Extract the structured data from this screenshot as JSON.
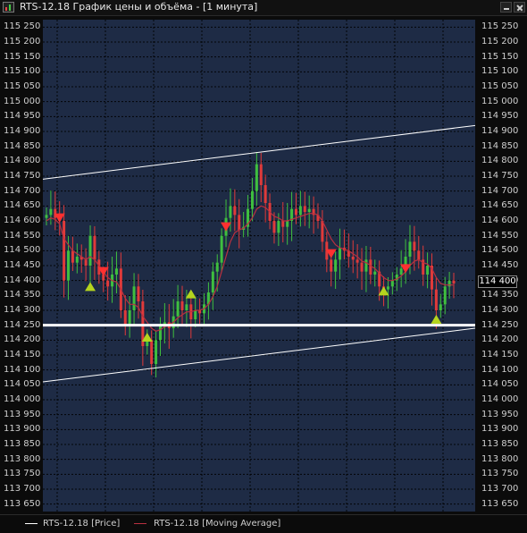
{
  "window": {
    "title": "RTS-12.18 График цены и объёма - [1 минута]"
  },
  "colors": {
    "plot_background": "#1e2b45",
    "grid": "#000000",
    "up_candle": "#3fbf3f",
    "down_candle": "#e03a3a",
    "moving_average": "#b83040",
    "trend_lines": "#ffffff",
    "buy_marker": "#b5d41e",
    "sell_marker": "#ff3030"
  },
  "price_axis": {
    "labels": [
      "115 250",
      "115 200",
      "115 150",
      "115 100",
      "115 050",
      "115 000",
      "114 950",
      "114 900",
      "114 850",
      "114 800",
      "114 750",
      "114 700",
      "114 650",
      "114 600",
      "114 550",
      "114 500",
      "114 450",
      "114 400",
      "114 350",
      "114 300",
      "114 250",
      "114 200",
      "114 150",
      "114 100",
      "114 050",
      "114 000",
      "113 950",
      "113 900",
      "113 850",
      "113 800",
      "113 750",
      "113 700",
      "113 650"
    ]
  },
  "current_price_tag": "114 400",
  "legend": {
    "items": [
      {
        "label": "RTS-12.18 [Price]",
        "color": "#ffffff"
      },
      {
        "label": "RTS-12.18 [Moving Average]",
        "color": "#b83040"
      }
    ]
  },
  "chart_data": {
    "type": "candlestick",
    "title": "",
    "ylim": [
      113625,
      115275
    ],
    "price_series_close": [
      114620,
      114640,
      114610,
      114600,
      114400,
      114500,
      114460,
      114480,
      114470,
      114450,
      114550,
      114470,
      114420,
      114400,
      114380,
      114420,
      114440,
      114300,
      114250,
      114300,
      114380,
      114330,
      114180,
      114200,
      114120,
      114200,
      114250,
      114260,
      114240,
      114280,
      114330,
      114300,
      114320,
      114270,
      114300,
      114290,
      114320,
      114360,
      114430,
      114460,
      114550,
      114610,
      114650,
      114620,
      114570,
      114580,
      114640,
      114700,
      114790,
      114720,
      114660,
      114600,
      114560,
      114600,
      114580,
      114600,
      114640,
      114620,
      114650,
      114630,
      114640,
      114620,
      114600,
      114530,
      114470,
      114430,
      114470,
      114510,
      114500,
      114480,
      114470,
      114460,
      114430,
      114470,
      114420,
      114430,
      114380,
      114370,
      114380,
      114400,
      114420,
      114440,
      114480,
      114530,
      114500,
      114470,
      114420,
      114450,
      114370,
      114300,
      114320,
      114380,
      114400,
      114390
    ],
    "moving_average": [
      114600,
      114610,
      114605,
      114590,
      114540,
      114520,
      114500,
      114490,
      114480,
      114470,
      114480,
      114470,
      114450,
      114430,
      114410,
      114400,
      114395,
      114370,
      114340,
      114320,
      114320,
      114310,
      114280,
      114260,
      114240,
      114230,
      114235,
      114245,
      114250,
      114260,
      114275,
      114285,
      114295,
      114295,
      114300,
      114300,
      114305,
      114320,
      114345,
      114380,
      114430,
      114480,
      114530,
      114560,
      114570,
      114575,
      114590,
      114610,
      114640,
      114650,
      114645,
      114630,
      114615,
      114610,
      114600,
      114600,
      114605,
      114610,
      114615,
      114620,
      114625,
      114625,
      114620,
      114600,
      114570,
      114540,
      114520,
      114510,
      114505,
      114500,
      114490,
      114480,
      114465,
      114460,
      114450,
      114440,
      114425,
      114410,
      114400,
      114400,
      114405,
      114415,
      114430,
      114450,
      114465,
      114470,
      114460,
      114455,
      114440,
      114410,
      114390,
      114385,
      114385,
      114385
    ],
    "buy_signals": [
      {
        "index": 10,
        "price": 114380
      },
      {
        "index": 23,
        "price": 114210
      },
      {
        "index": 33,
        "price": 114355
      },
      {
        "index": 77,
        "price": 114365
      },
      {
        "index": 89,
        "price": 114270
      }
    ],
    "sell_signals": [
      {
        "index": 3,
        "price": 114610
      },
      {
        "index": 13,
        "price": 114430
      },
      {
        "index": 41,
        "price": 114580
      },
      {
        "index": 65,
        "price": 114490
      },
      {
        "index": 82,
        "price": 114440
      }
    ],
    "horizontal_line": 114250,
    "trend_lines": [
      {
        "from_price": 114740,
        "to_price": 114920
      },
      {
        "from_price": 114060,
        "to_price": 114240
      }
    ]
  }
}
